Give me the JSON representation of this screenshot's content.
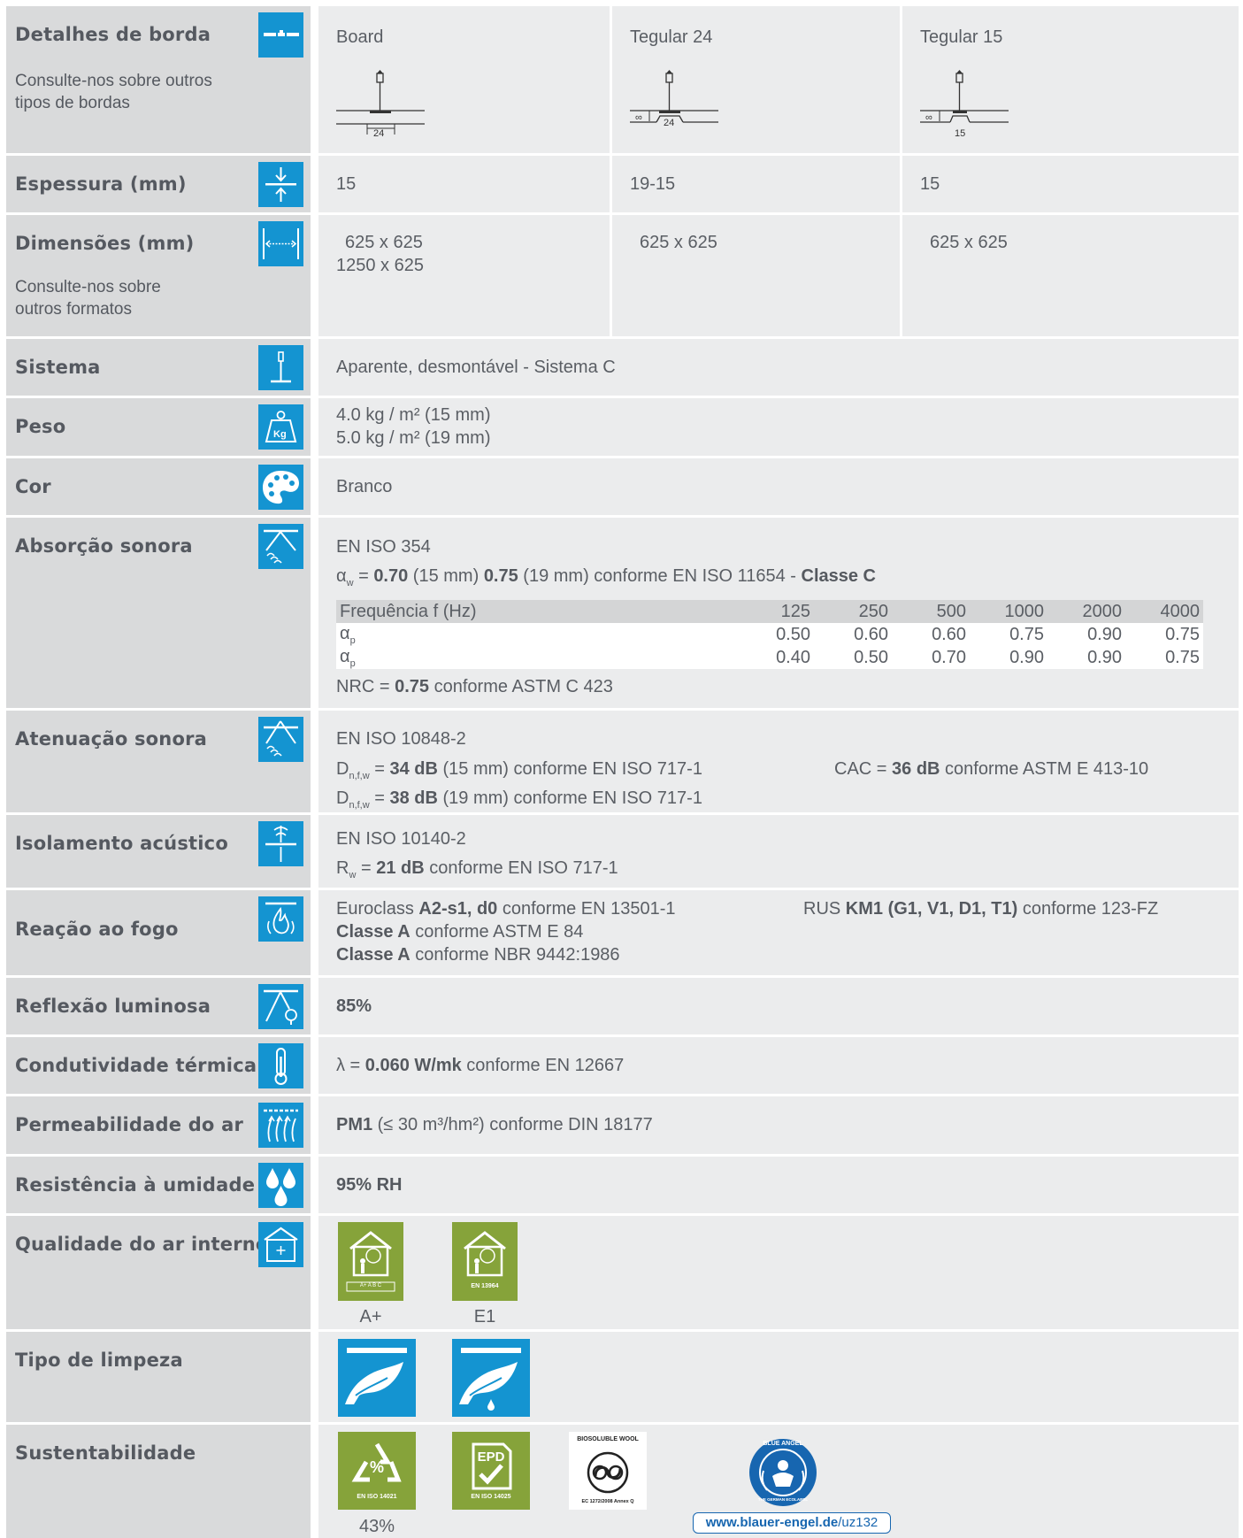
{
  "rows": {
    "borda": {
      "label": "Detalhes de borda",
      "sub": "Consulte-nos sobre outros tipos de bordas",
      "cols": [
        "Board",
        "Tegular 24",
        "Tegular 15"
      ],
      "dims": [
        "24",
        "24",
        "15"
      ]
    },
    "espessura": {
      "label": "Espessura (mm)",
      "cols": [
        "15",
        "19-15",
        "15"
      ]
    },
    "dimensoes": {
      "label": "Dimensões (mm)",
      "sub": "Consulte-nos sobre outros formatos",
      "col1a": "625 x 625",
      "col1b": "1250 x 625",
      "col2": "625 x 625",
      "col3": "625 x 625"
    },
    "sistema": {
      "label": "Sistema",
      "value": "Aparente, desmontável - Sistema C"
    },
    "peso": {
      "label": "Peso",
      "line1": "4.0 kg / m² (15 mm)",
      "line2": "5.0 kg / m² (19 mm)"
    },
    "cor": {
      "label": "Cor",
      "value": "Branco"
    },
    "absorcao": {
      "label": "Absorção sonora",
      "std": "EN ISO 354",
      "aw_sym": "α",
      "aw_sub": "w",
      "aw_eq": " = ",
      "aw1": "0.70",
      "aw1_t": " (15 mm) ",
      "aw2": "0.75",
      "aw2_t": " (19 mm) conforme EN ISO 11654 - ",
      "aw_class": "Classe C",
      "freq_label": "Frequência f (Hz)",
      "freqs": [
        "125",
        "250",
        "500",
        "1000",
        "2000",
        "4000"
      ],
      "ap_sym": "α",
      "ap_sub": "p",
      "ap1": [
        "0.50",
        "0.60",
        "0.60",
        "0.75",
        "0.90",
        "0.75"
      ],
      "ap2": [
        "0.40",
        "0.50",
        "0.70",
        "0.90",
        "0.90",
        "0.75"
      ],
      "nrc_pre": "NRC = ",
      "nrc": "0.75",
      "nrc_post": " conforme ASTM C 423"
    },
    "atenuacao": {
      "label": "Atenuação sonora",
      "std": "EN ISO 10848-2",
      "d_sym": "D",
      "d_sub": "n,f,w",
      "eq": " = ",
      "d1": "34 dB",
      "d1_t": " (15 mm) conforme EN ISO 717-1",
      "d2": "38 dB",
      "d2_t": " (19 mm) conforme EN ISO 717-1",
      "cac_pre": "CAC = ",
      "cac": "36 dB",
      "cac_post": " conforme ASTM E 413-10"
    },
    "isolamento": {
      "label": "Isolamento acústico",
      "std": "EN ISO 10140-2",
      "r_sym": "R",
      "r_sub": "w",
      "eq": " = ",
      "rw": "21 dB",
      "rw_t": " conforme EN ISO 717-1"
    },
    "fogo": {
      "label": "Reação ao fogo",
      "l1_pre": "Euroclass ",
      "l1_b": "A2-s1, d0",
      "l1_post": " conforme EN 13501-1",
      "l2_b": "Classe A",
      "l2_post": " conforme ASTM E 84",
      "l3_b": "Classe A",
      "l3_post": " conforme NBR 9442:1986",
      "rus_pre": "RUS ",
      "rus_b": "KM1 (G1, V1, D1, T1)",
      "rus_post": " conforme 123-FZ"
    },
    "reflexao": {
      "label": "Reflexão luminosa",
      "value": "85%"
    },
    "condutividade": {
      "label": "Condutividade térmica",
      "pre": "λ = ",
      "b": "0.060 W/mk",
      "post": " conforme EN 12667"
    },
    "permeabilidade": {
      "label": "Permeabilidade do ar",
      "b": "PM1",
      "post": " (≤ 30 m³/hm²) conforme DIN 18177"
    },
    "umidade": {
      "label": "Resistência à umidade",
      "value": "95% RH"
    },
    "ar": {
      "label": "Qualidade do ar interno",
      "c1": "A+",
      "c2": "E1",
      "b1": "A+ A B C",
      "b2": "EN 13964"
    },
    "limpeza": {
      "label": "Tipo de limpeza"
    },
    "sustent": {
      "label": "Sustentabilidade",
      "c1": "43%",
      "iso1": "EN ISO 14021",
      "pct": "%",
      "epd": "EPD",
      "iso2": "EN ISO 14025",
      "bio_title": "BIOSOLUBLE WOOL",
      "bio_foot": "EC 1272/2008 Annex Q",
      "ba_title": "BLUE ANGEL",
      "ba_foot": "THE GERMAN ECOLABEL",
      "url_b": "www.blauer-engel.de",
      "url_t": "/uz132"
    }
  },
  "colors": {
    "accent": "#1494d1",
    "green": "#86a33a",
    "label_bg": "#d9dadb",
    "value_bg": "#ebeced"
  }
}
